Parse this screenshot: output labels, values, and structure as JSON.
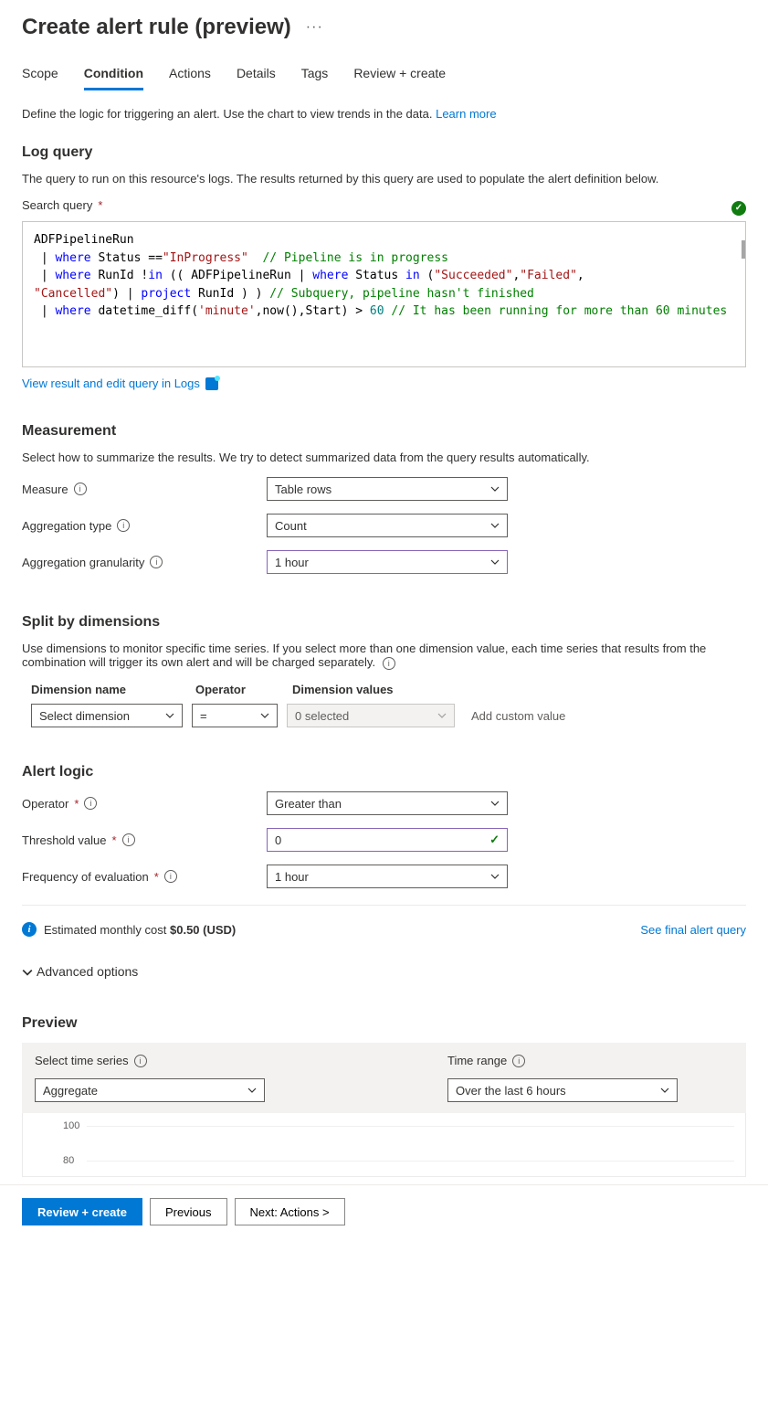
{
  "title": "Create alert rule (preview)",
  "tabs": [
    "Scope",
    "Condition",
    "Actions",
    "Details",
    "Tags",
    "Review + create"
  ],
  "activeTab": 1,
  "intro": "Define the logic for triggering an alert. Use the chart to view trends in the data.",
  "learnMore": "Learn more",
  "logQuery": {
    "heading": "Log query",
    "desc": "The query to run on this resource's logs. The results returned by this query are used to populate the alert definition below.",
    "searchLabel": "Search query",
    "viewLink": "View result and edit query in Logs",
    "code": {
      "l1a": "ADFPipelineRun",
      "l2a": " | ",
      "l2b": "where",
      "l2c": " Status ==",
      "l2d": "\"InProgress\"",
      "l2e": "  // Pipeline is in progress",
      "l3a": " | ",
      "l3b": "where",
      "l3c": " RunId !",
      "l3d": "in",
      "l3e": " (( ADFPipelineRun | ",
      "l3f": "where",
      "l3g": " Status ",
      "l3h": "in",
      "l3i": " (",
      "l3j": "\"Succeeded\"",
      "l3k": ",",
      "l3l": "\"Failed\"",
      "l3m": ",",
      "l4a": "\"Cancelled\"",
      "l4b": ") | ",
      "l4c": "project",
      "l4d": " RunId ) ) ",
      "l4e": "// Subquery, pipeline hasn't finished",
      "l5a": " | ",
      "l5b": "where",
      "l5c": " datetime_diff(",
      "l5d": "'minute'",
      "l5e": ",now(),Start) > ",
      "l5f": "60",
      "l5g": " // It has been running for more than 60 minutes"
    }
  },
  "measurement": {
    "heading": "Measurement",
    "desc": "Select how to summarize the results. We try to detect summarized data from the query results automatically.",
    "measureLabel": "Measure",
    "measureValue": "Table rows",
    "aggTypeLabel": "Aggregation type",
    "aggTypeValue": "Count",
    "aggGranLabel": "Aggregation granularity",
    "aggGranValue": "1 hour"
  },
  "split": {
    "heading": "Split by dimensions",
    "desc": "Use dimensions to monitor specific time series. If you select more than one dimension value, each time series that results from the combination will trigger its own alert and will be charged separately.",
    "cols": [
      "Dimension name",
      "Operator",
      "Dimension values"
    ],
    "namePlaceholder": "Select dimension",
    "opValue": "=",
    "valPlaceholder": "0 selected",
    "custom": "Add custom value"
  },
  "alertLogic": {
    "heading": "Alert logic",
    "operatorLabel": "Operator",
    "operatorValue": "Greater than",
    "thresholdLabel": "Threshold value",
    "thresholdValue": "0",
    "freqLabel": "Frequency of evaluation",
    "freqValue": "1 hour"
  },
  "cost": {
    "label": "Estimated monthly cost ",
    "value": "$0.50 (USD)",
    "finalLink": "See final alert query"
  },
  "advanced": "Advanced options",
  "preview": {
    "heading": "Preview",
    "seriesLabel": "Select time series",
    "seriesValue": "Aggregate",
    "rangeLabel": "Time range",
    "rangeValue": "Over the last 6 hours"
  },
  "chart_data": {
    "type": "line",
    "title": "",
    "xlabel": "",
    "ylabel": "",
    "ylim": [
      0,
      100
    ],
    "yticks": [
      80,
      100
    ],
    "x": [],
    "series": []
  },
  "footer": {
    "review": "Review + create",
    "prev": "Previous",
    "next": "Next: Actions >"
  }
}
